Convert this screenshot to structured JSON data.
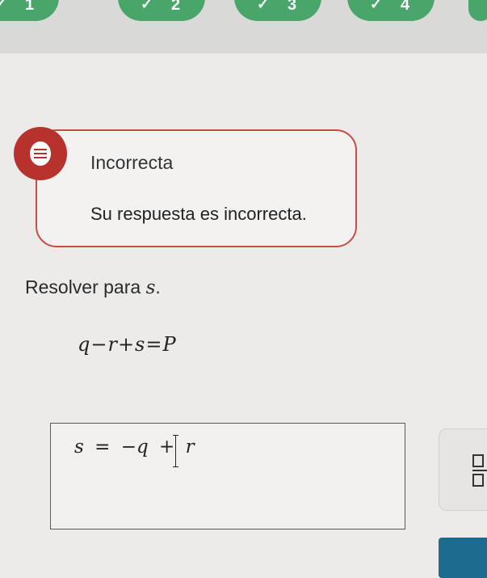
{
  "progress": {
    "steps": [
      {
        "number": "1",
        "status": "correct"
      },
      {
        "number": "2",
        "status": "correct"
      },
      {
        "number": "3",
        "status": "correct"
      },
      {
        "number": "4",
        "status": "correct"
      }
    ]
  },
  "feedback": {
    "title": "Incorrecta",
    "message": "Su respuesta es incorrecta.",
    "icon": "feedback-icon"
  },
  "question": {
    "prompt_prefix": "Resolver para",
    "prompt_var": "s",
    "prompt_suffix": ".",
    "equation": "q−r+s=P"
  },
  "answer": {
    "value": "s = −q + r"
  },
  "tools": {
    "fraction_icon": "fraction-icon"
  },
  "colors": {
    "correct": "#4aa56a",
    "incorrect": "#b8322d",
    "accent": "#1a6b8e"
  }
}
